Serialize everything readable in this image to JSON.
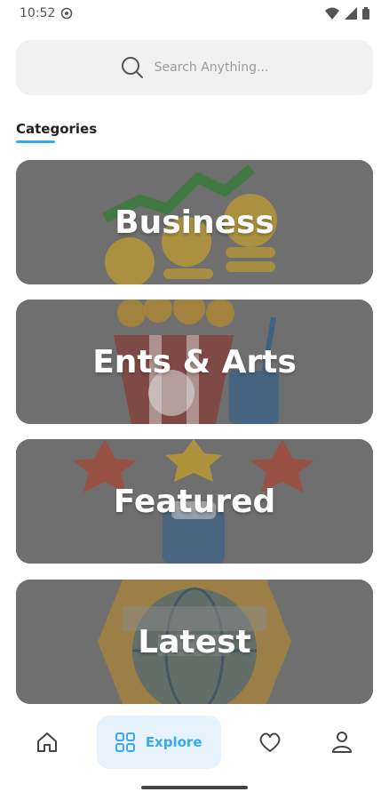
{
  "status": {
    "time": "10:52"
  },
  "search": {
    "placeholder": "Search Anything..."
  },
  "section": {
    "title": "Categories"
  },
  "categories": [
    {
      "label": "Business"
    },
    {
      "label": "Ents & Arts"
    },
    {
      "label": "Featured"
    },
    {
      "label": "Latest"
    }
  ],
  "nav": {
    "items": [
      {
        "icon": "home-icon"
      },
      {
        "icon": "explore-grid-icon",
        "label": "Explore"
      },
      {
        "icon": "heart-icon"
      },
      {
        "icon": "profile-icon"
      }
    ]
  },
  "colors": {
    "accent": "#3aa8ee",
    "overlay": "#6f6f6f"
  }
}
